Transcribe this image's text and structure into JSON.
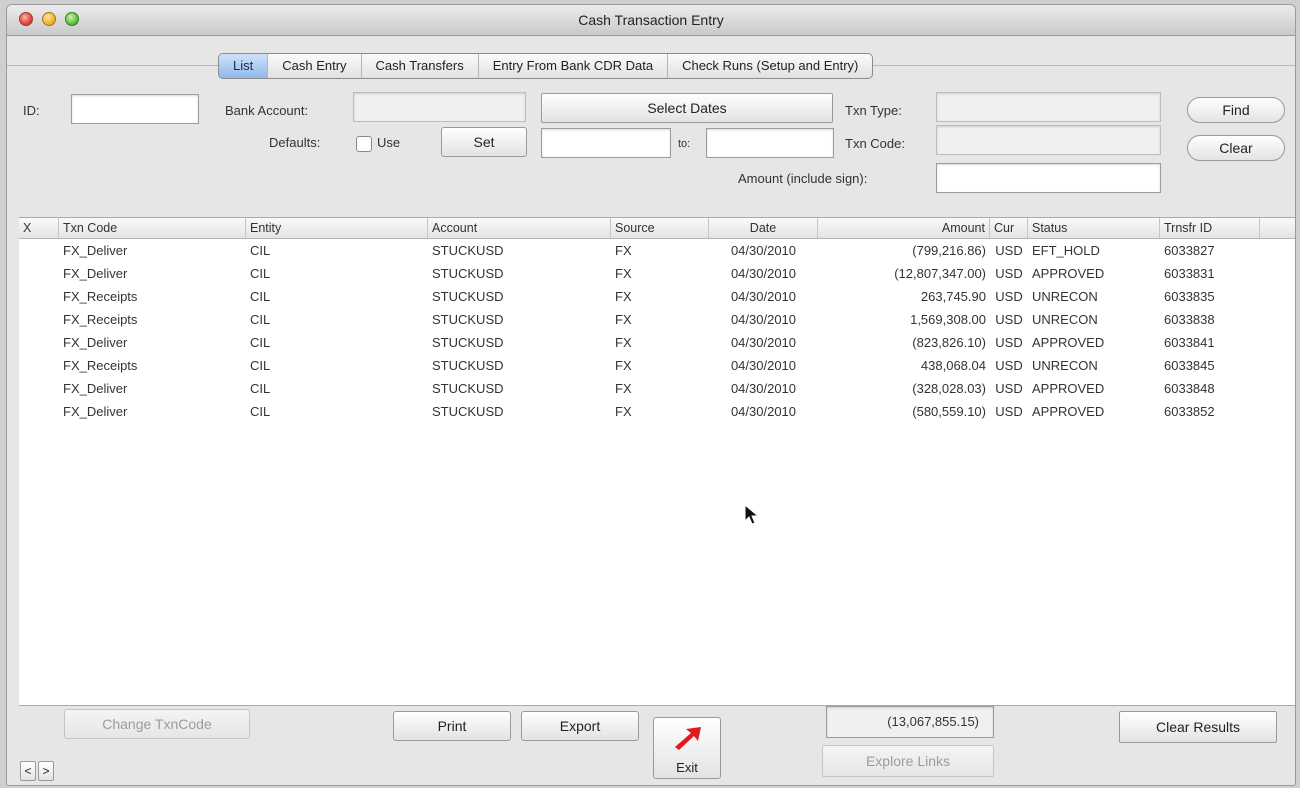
{
  "window": {
    "title": "Cash Transaction Entry"
  },
  "tabs": [
    "List",
    "Cash Entry",
    "Cash Transfers",
    "Entry From Bank CDR Data",
    "Check Runs (Setup and Entry)"
  ],
  "filters": {
    "id_label": "ID:",
    "id_value": "",
    "bank_account_label": "Bank Account:",
    "bank_account_value": "",
    "defaults_label": "Defaults:",
    "use_label": "Use",
    "use_checked": false,
    "set_label": "Set",
    "select_dates_label": "Select Dates",
    "date_from": "",
    "to_label": "to:",
    "date_to": "",
    "txn_type_label": "Txn Type:",
    "txn_type_value": "",
    "txn_code_label": "Txn Code:",
    "txn_code_value": "",
    "amount_label": "Amount (include sign):",
    "amount_value": "",
    "find_label": "Find",
    "clear_label": "Clear"
  },
  "table": {
    "columns": [
      "X",
      "Txn Code",
      "Entity",
      "Account",
      "Source",
      "Date",
      "Amount",
      "Cur",
      "Status",
      "Trnsfr ID"
    ],
    "rows": [
      [
        "",
        "FX_Deliver",
        "CIL",
        "STUCKUSD",
        "FX",
        "04/30/2010",
        "(799,216.86)",
        "USD",
        "EFT_HOLD",
        "6033827"
      ],
      [
        "",
        "FX_Deliver",
        "CIL",
        "STUCKUSD",
        "FX",
        "04/30/2010",
        "(12,807,347.00)",
        "USD",
        "APPROVED",
        "6033831"
      ],
      [
        "",
        "FX_Receipts",
        "CIL",
        "STUCKUSD",
        "FX",
        "04/30/2010",
        "263,745.90",
        "USD",
        "UNRECON",
        "6033835"
      ],
      [
        "",
        "FX_Receipts",
        "CIL",
        "STUCKUSD",
        "FX",
        "04/30/2010",
        "1,569,308.00",
        "USD",
        "UNRECON",
        "6033838"
      ],
      [
        "",
        "FX_Deliver",
        "CIL",
        "STUCKUSD",
        "FX",
        "04/30/2010",
        "(823,826.10)",
        "USD",
        "APPROVED",
        "6033841"
      ],
      [
        "",
        "FX_Receipts",
        "CIL",
        "STUCKUSD",
        "FX",
        "04/30/2010",
        "438,068.04",
        "USD",
        "UNRECON",
        "6033845"
      ],
      [
        "",
        "FX_Deliver",
        "CIL",
        "STUCKUSD",
        "FX",
        "04/30/2010",
        "(328,028.03)",
        "USD",
        "APPROVED",
        "6033848"
      ],
      [
        "",
        "FX_Deliver",
        "CIL",
        "STUCKUSD",
        "FX",
        "04/30/2010",
        "(580,559.10)",
        "USD",
        "APPROVED",
        "6033852"
      ]
    ]
  },
  "footer": {
    "change_txncode_label": "Change TxnCode",
    "print_label": "Print",
    "export_label": "Export",
    "exit_label": "Exit",
    "total": "(13,067,855.15)",
    "explore_links_label": "Explore Links",
    "clear_results_label": "Clear Results",
    "prev_label": "<",
    "next_label": ">"
  },
  "icons": {
    "exit": "red-arrow-icon",
    "cursor": "mouse-pointer-icon"
  },
  "colors": {
    "active_tab": "#8fb8ea",
    "exit_arrow": "#e01b1b"
  }
}
